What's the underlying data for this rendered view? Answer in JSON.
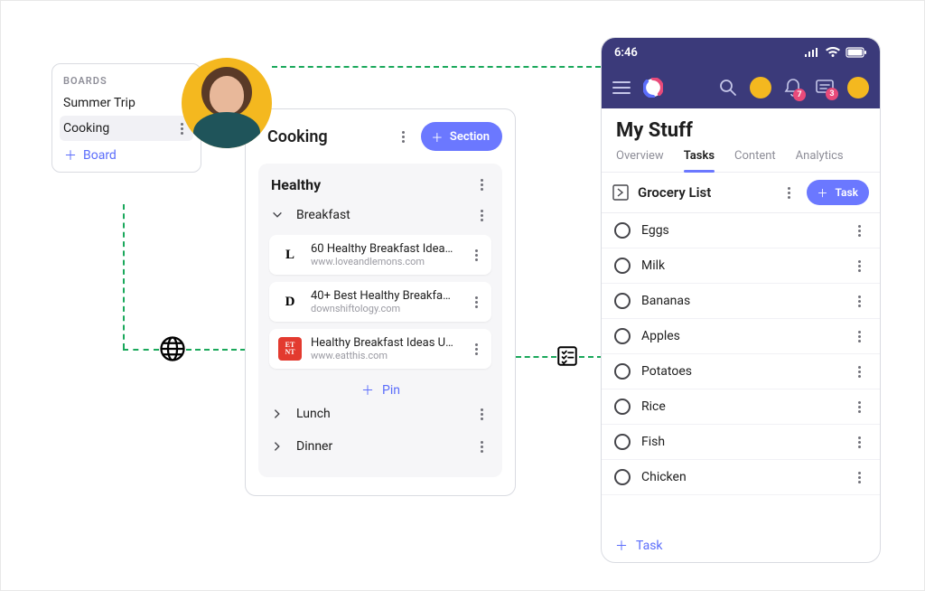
{
  "boards": {
    "title": "BOARDS",
    "items": [
      "Summer Trip",
      "Cooking"
    ],
    "selected": "Cooking",
    "add_label": "Board"
  },
  "cooking": {
    "title": "Cooking",
    "add_section_label": "Section",
    "healthy_title": "Healthy",
    "meals": {
      "breakfast": {
        "label": "Breakfast",
        "expanded": true
      },
      "lunch": {
        "label": "Lunch",
        "expanded": false
      },
      "dinner": {
        "label": "Dinner",
        "expanded": false
      }
    },
    "pins": [
      {
        "title": "60 Healthy Breakfast Idea…",
        "domain": "www.loveandlemons.com",
        "icon_text": "L",
        "icon_bg": "#ffffff",
        "icon_fg": "#000000"
      },
      {
        "title": "40+ Best Healthy Breakfa…",
        "domain": "downshiftology.com",
        "icon_text": "D",
        "icon_bg": "#ffffff",
        "icon_fg": "#000000"
      },
      {
        "title": "Healthy Breakfast Ideas U…",
        "domain": "www.eatthis.com",
        "icon_text": "ET\nNT",
        "icon_bg": "#E33A2F",
        "icon_fg": "#ffffff"
      }
    ],
    "add_pin_label": "Pin"
  },
  "phone": {
    "status_time": "6:46",
    "title": "My Stuff",
    "tabs": [
      "Overview",
      "Tasks",
      "Content",
      "Analytics"
    ],
    "active_tab": "Tasks",
    "list_title": "Grocery List",
    "task_button_label": "Task",
    "tasks": [
      "Eggs",
      "Milk",
      "Bananas",
      "Apples",
      "Potatoes",
      "Rice",
      "Fish",
      "Chicken"
    ],
    "add_task_label": "Task",
    "notification_badge": "7",
    "message_badge": "3"
  },
  "colors": {
    "accent": "#6B78FF",
    "connector": "#1AA85B",
    "phone_header": "#3B3A7A"
  }
}
